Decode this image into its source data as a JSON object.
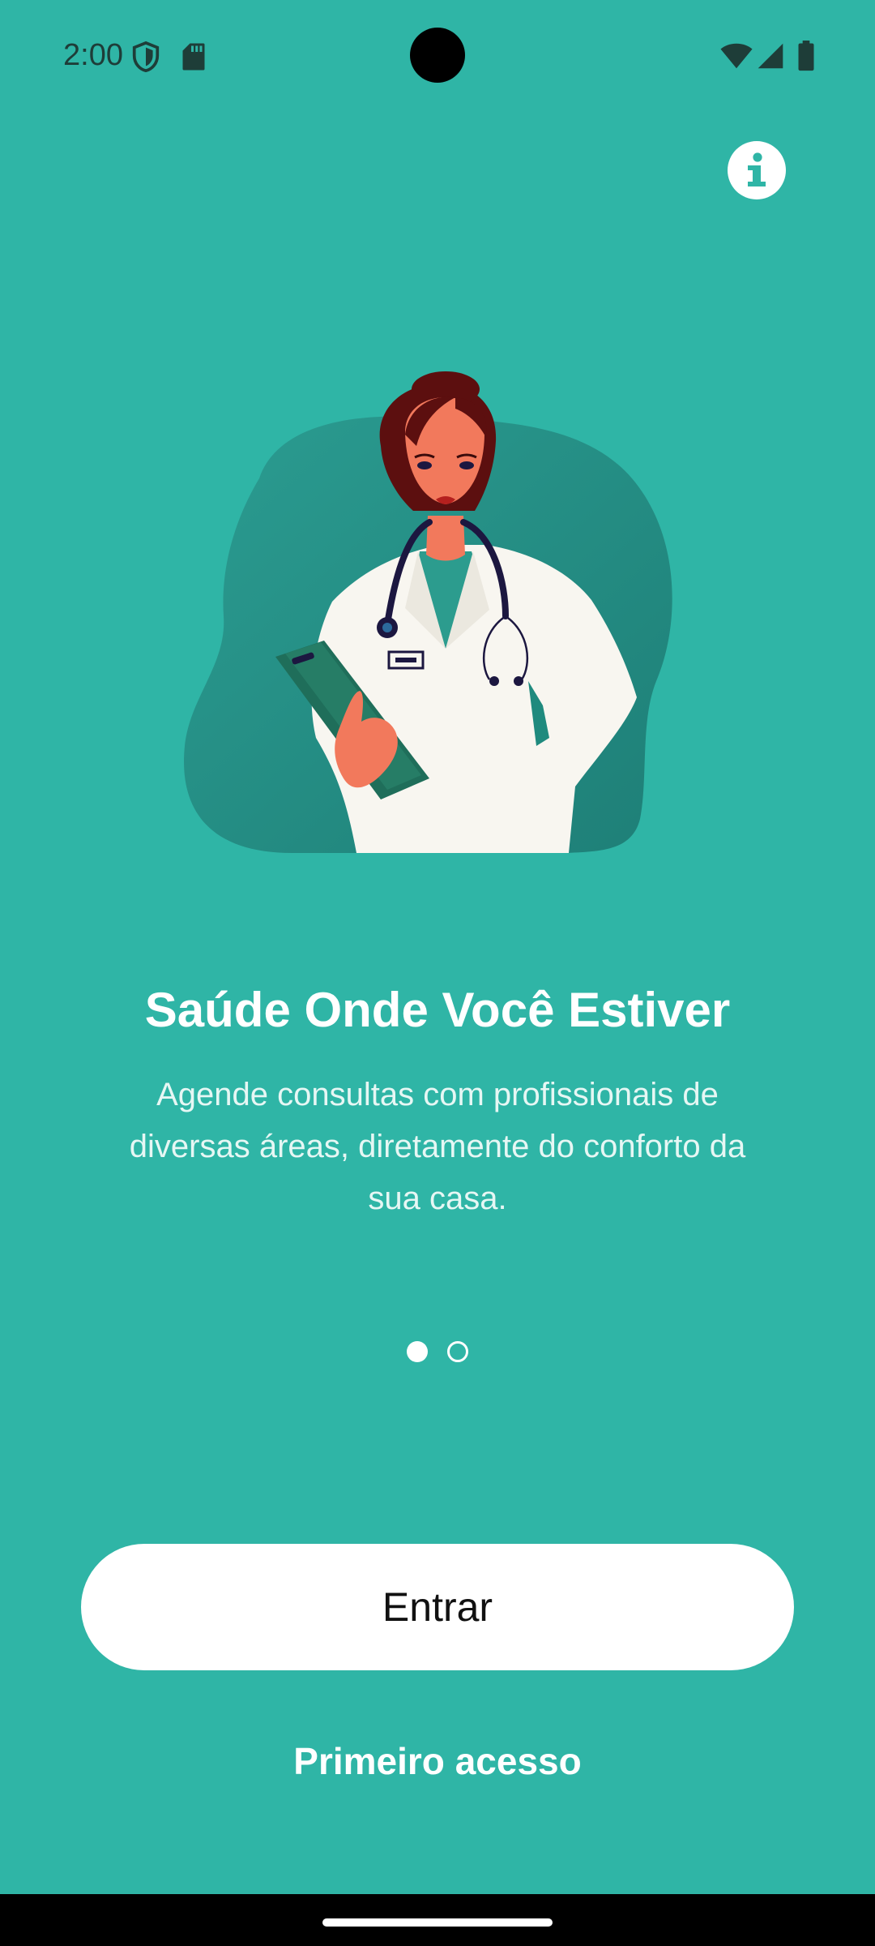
{
  "status_bar": {
    "time": "2:00",
    "icons": [
      "shield-icon",
      "sd-card-icon",
      "wifi-icon",
      "signal-icon",
      "battery-icon"
    ]
  },
  "header": {
    "info_icon": "info-icon"
  },
  "onboarding": {
    "title": "Saúde Onde Você Estiver",
    "description": "Agende consultas com profissionais de diversas áreas, diretamente do conforto da sua casa.",
    "page_index": 1,
    "page_count": 2
  },
  "actions": {
    "primary_label": "Entrar",
    "secondary_label": "Primeiro acesso"
  },
  "colors": {
    "background": "#2fb5a6",
    "button_bg": "#ffffff",
    "text_light": "#ffffff"
  }
}
